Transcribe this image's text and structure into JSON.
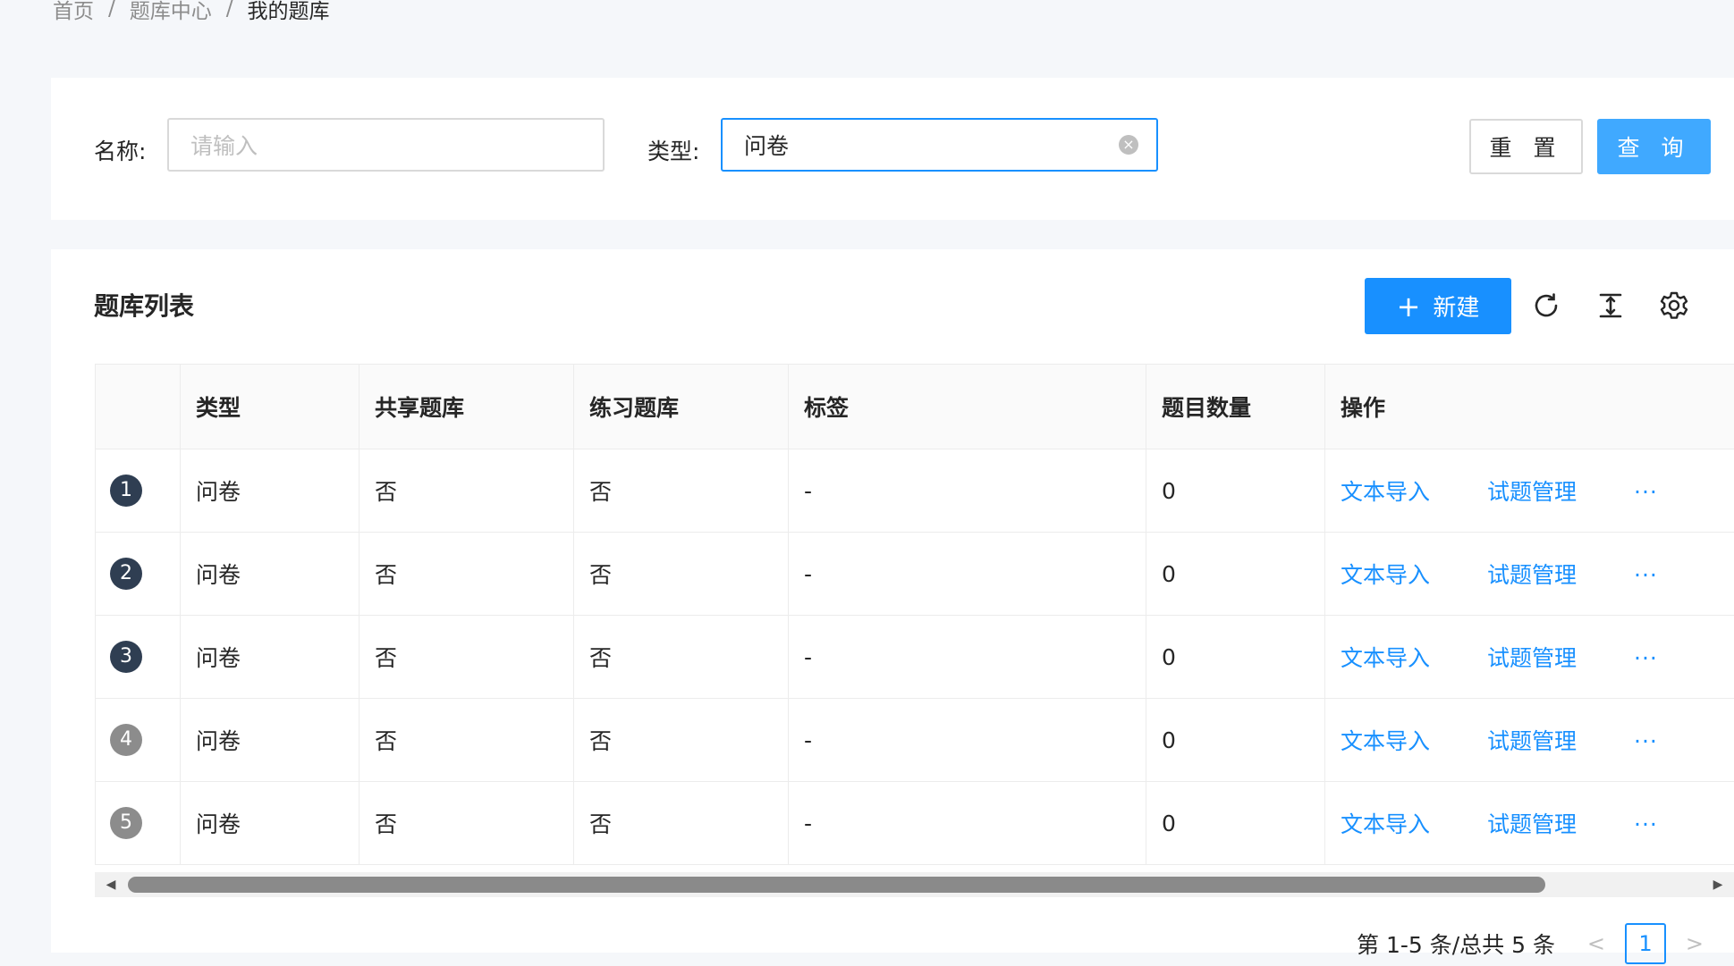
{
  "breadcrumb": {
    "items": [
      "首页",
      "题库中心",
      "我的题库"
    ],
    "separator": "/"
  },
  "filter": {
    "name_label": "名称:",
    "name_placeholder": "请输入",
    "type_label": "类型:",
    "type_value": "问卷",
    "reset_label": "重 置",
    "query_label": "查 询"
  },
  "list": {
    "title": "题库列表",
    "new_button": "新建",
    "columns": [
      "",
      "类型",
      "共享题库",
      "练习题库",
      "标签",
      "题目数量",
      "操作"
    ],
    "rows": [
      {
        "index": "1",
        "type": "问卷",
        "shared": "否",
        "practice": "否",
        "tags": "-",
        "count": "0"
      },
      {
        "index": "2",
        "type": "问卷",
        "shared": "否",
        "practice": "否",
        "tags": "-",
        "count": "0"
      },
      {
        "index": "3",
        "type": "问卷",
        "shared": "否",
        "practice": "否",
        "tags": "-",
        "count": "0"
      },
      {
        "index": "4",
        "type": "问卷",
        "shared": "否",
        "practice": "否",
        "tags": "-",
        "count": "0"
      },
      {
        "index": "5",
        "type": "问卷",
        "shared": "否",
        "practice": "否",
        "tags": "-",
        "count": "0"
      }
    ],
    "action_import": "文本导入",
    "action_manage": "试题管理",
    "action_more": "···"
  },
  "pagination": {
    "summary": "第 1-5 条/总共 5 条",
    "current_page": "1",
    "prev": "<",
    "next": ">"
  },
  "colors": {
    "primary": "#1890ff",
    "primary_light": "#40a9ff",
    "badge_dark": "#2f3e52",
    "badge_gray": "#8c8c8c"
  }
}
